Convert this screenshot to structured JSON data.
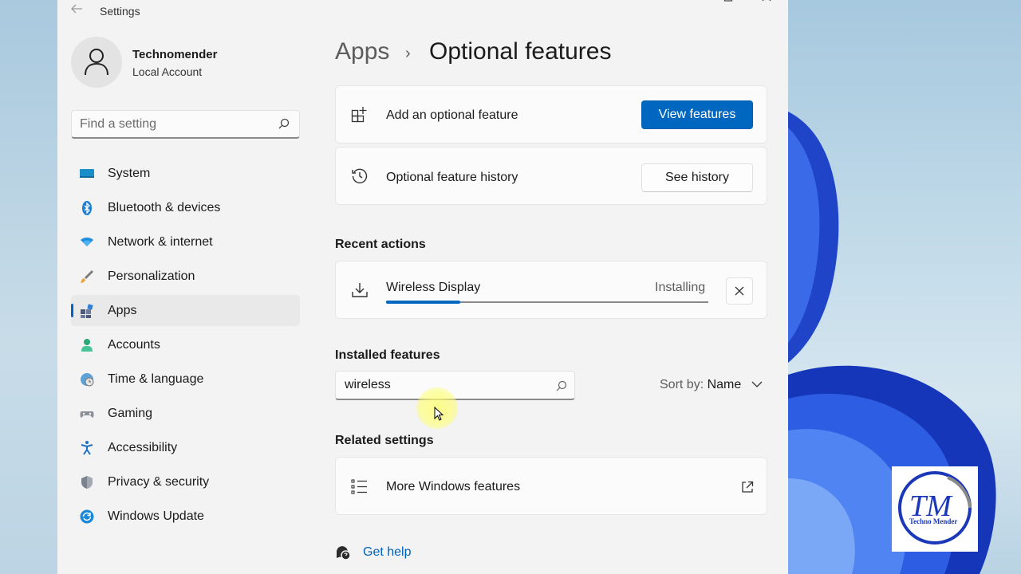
{
  "window": {
    "title": "Settings"
  },
  "profile": {
    "name": "Technomender",
    "account_type": "Local Account"
  },
  "search": {
    "placeholder": "Find a setting"
  },
  "sidebar": {
    "items": [
      {
        "label": "System",
        "icon": "monitor-icon",
        "active": false
      },
      {
        "label": "Bluetooth & devices",
        "icon": "bluetooth-icon",
        "active": false
      },
      {
        "label": "Network & internet",
        "icon": "wifi-icon",
        "active": false
      },
      {
        "label": "Personalization",
        "icon": "brush-icon",
        "active": false
      },
      {
        "label": "Apps",
        "icon": "apps-icon",
        "active": true
      },
      {
        "label": "Accounts",
        "icon": "person-icon",
        "active": false
      },
      {
        "label": "Time & language",
        "icon": "globe-clock-icon",
        "active": false
      },
      {
        "label": "Gaming",
        "icon": "gamepad-icon",
        "active": false
      },
      {
        "label": "Accessibility",
        "icon": "accessibility-icon",
        "active": false
      },
      {
        "label": "Privacy & security",
        "icon": "shield-icon",
        "active": false
      },
      {
        "label": "Windows Update",
        "icon": "update-icon",
        "active": false
      }
    ]
  },
  "breadcrumb": {
    "parent": "Apps",
    "separator": "›",
    "current": "Optional features"
  },
  "add_feature": {
    "label": "Add an optional feature",
    "button": "View features",
    "icon": "add-feature-icon"
  },
  "history": {
    "label": "Optional feature history",
    "button": "See history",
    "icon": "history-icon"
  },
  "recent_actions": {
    "title": "Recent actions",
    "item": {
      "name": "Wireless Display",
      "status": "Installing",
      "progress": 0.23,
      "icon": "download-icon"
    }
  },
  "installed": {
    "title": "Installed features",
    "search_value": "wireless",
    "sort_label": "Sort by:",
    "sort_value": "Name"
  },
  "related": {
    "title": "Related settings",
    "item": {
      "label": "More Windows features",
      "icon": "list-icon"
    }
  },
  "help": {
    "label": "Get help"
  },
  "watermark": {
    "initials": "TM",
    "text": "Techno Mender"
  },
  "colors": {
    "accent": "#0067c0",
    "window_bg": "#f3f3f3",
    "card_bg": "#fbfbfb",
    "link": "#0062b8"
  }
}
